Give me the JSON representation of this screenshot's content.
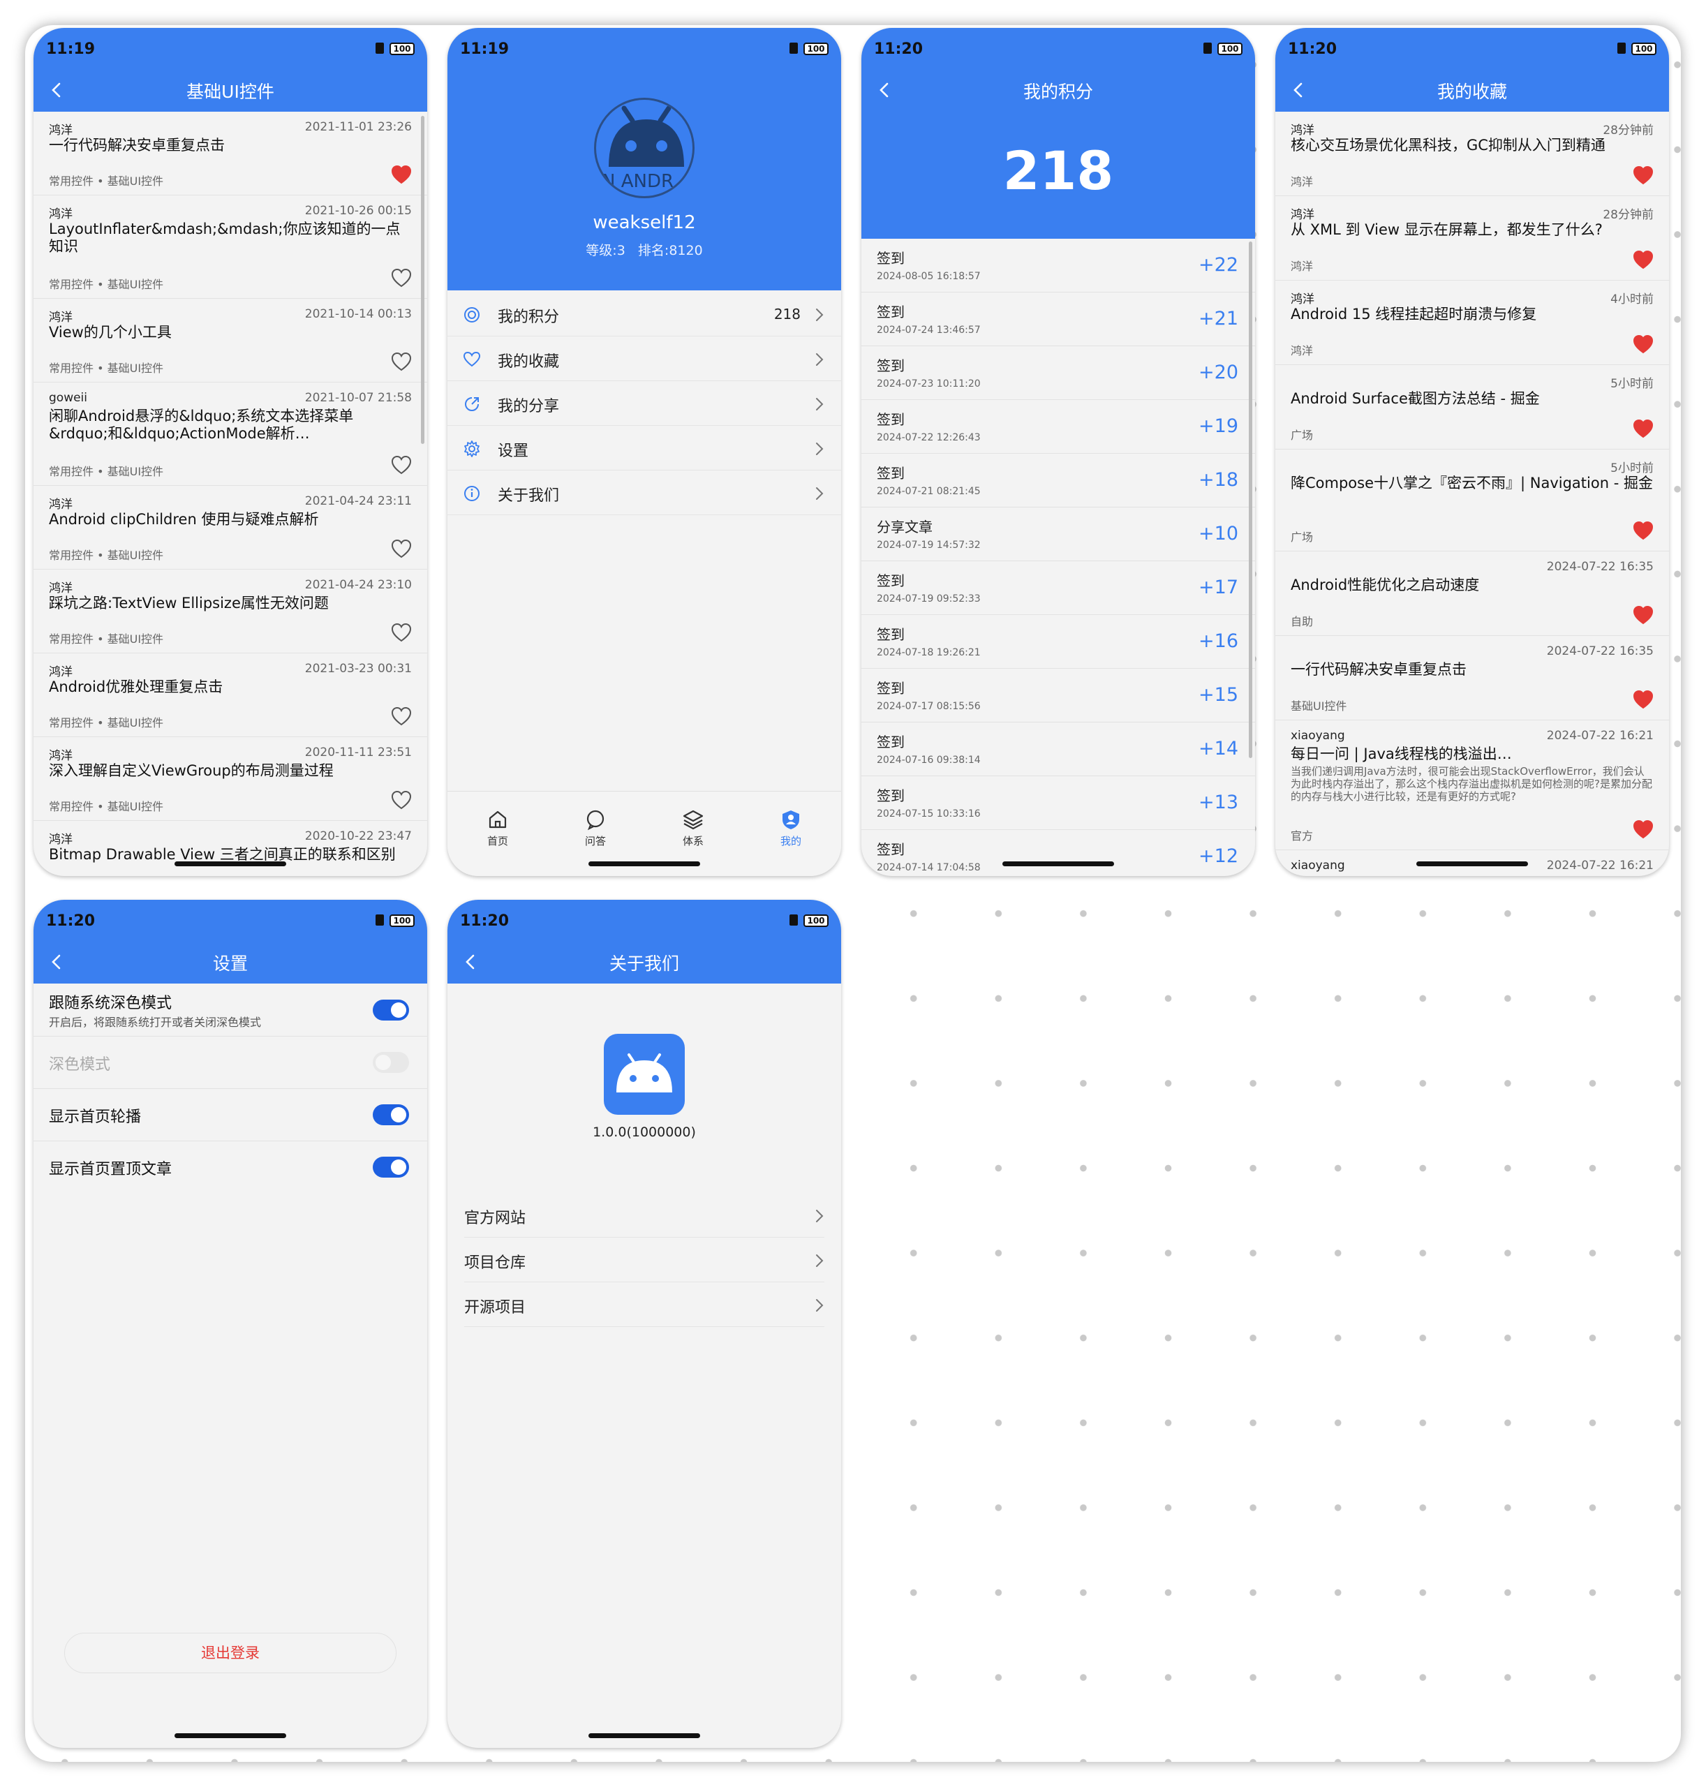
{
  "status": {
    "time_a": "11:19",
    "time_b": "11:20",
    "battery": "100"
  },
  "colors": {
    "primary": "#3a7ff0",
    "heart_active": "#e53935",
    "toggle_on": "#1d5fe0",
    "logout": "#e53935"
  },
  "screen1": {
    "title": "基础UI控件",
    "items": [
      {
        "author": "鸿洋",
        "date": "2021-11-01 23:26",
        "title": "一行代码解决安卓重复点击",
        "tags": "常用控件 • 基础UI控件",
        "liked": true
      },
      {
        "author": "鸿洋",
        "date": "2021-10-26 00:15",
        "title": "LayoutInflater&mdash;&mdash;你应该知道的一点知识",
        "tags": "常用控件 • 基础UI控件",
        "liked": false
      },
      {
        "author": "鸿洋",
        "date": "2021-10-14 00:13",
        "title": "View的几个小工具",
        "tags": "常用控件 • 基础UI控件",
        "liked": false
      },
      {
        "author": "goweii",
        "date": "2021-10-07 21:58",
        "title": "闲聊Android悬浮的&ldquo;系统文本选择菜单&rdquo;和&ldquo;ActionMode解析…",
        "tags": "常用控件 • 基础UI控件",
        "liked": false
      },
      {
        "author": "鸿洋",
        "date": "2021-04-24 23:11",
        "title": "Android clipChildren 使用与疑难点解析",
        "tags": "常用控件 • 基础UI控件",
        "liked": false
      },
      {
        "author": "鸿洋",
        "date": "2021-04-24 23:10",
        "title": "踩坑之路:TextView Ellipsize属性无效问题",
        "tags": "常用控件 • 基础UI控件",
        "liked": false
      },
      {
        "author": "鸿洋",
        "date": "2021-03-23 00:31",
        "title": "Android优雅处理重复点击",
        "tags": "常用控件 • 基础UI控件",
        "liked": false
      },
      {
        "author": "鸿洋",
        "date": "2020-11-11 23:51",
        "title": "深入理解自定义ViewGroup的布局测量过程",
        "tags": "常用控件 • 基础UI控件",
        "liked": false
      },
      {
        "author": "鸿洋",
        "date": "2020-10-22 23:47",
        "title": "Bitmap Drawable View 三者之间真正的联系和区别",
        "tags": "",
        "liked": false
      }
    ]
  },
  "screen2": {
    "username": "weakself12",
    "level": "等级:3",
    "rank": "排名:8120",
    "avatar_text": "N ANDR",
    "menu": [
      {
        "label": "我的积分",
        "value": "218",
        "icon": "points-icon"
      },
      {
        "label": "我的收藏",
        "value": "",
        "icon": "heart-outline-icon"
      },
      {
        "label": "我的分享",
        "value": "",
        "icon": "share-icon"
      },
      {
        "label": "设置",
        "value": "",
        "icon": "gear-icon"
      },
      {
        "label": "关于我们",
        "value": "",
        "icon": "info-icon"
      }
    ],
    "tabs": [
      {
        "label": "首页",
        "icon": "home-icon",
        "active": false
      },
      {
        "label": "问答",
        "icon": "chat-icon",
        "active": false
      },
      {
        "label": "体系",
        "icon": "layers-icon",
        "active": false
      },
      {
        "label": "我的",
        "icon": "user-shield-icon",
        "active": true
      }
    ]
  },
  "screen3": {
    "title": "我的积分",
    "total": "218",
    "records": [
      {
        "type": "签到",
        "date": "2024-08-05 16:18:57",
        "points": "+22"
      },
      {
        "type": "签到",
        "date": "2024-07-24 13:46:57",
        "points": "+21"
      },
      {
        "type": "签到",
        "date": "2024-07-23 10:11:20",
        "points": "+20"
      },
      {
        "type": "签到",
        "date": "2024-07-22 12:26:43",
        "points": "+19"
      },
      {
        "type": "签到",
        "date": "2024-07-21 08:21:45",
        "points": "+18"
      },
      {
        "type": "分享文章",
        "date": "2024-07-19 14:57:32",
        "points": "+10"
      },
      {
        "type": "签到",
        "date": "2024-07-19 09:52:33",
        "points": "+17"
      },
      {
        "type": "签到",
        "date": "2024-07-18 19:26:21",
        "points": "+16"
      },
      {
        "type": "签到",
        "date": "2024-07-17 08:15:56",
        "points": "+15"
      },
      {
        "type": "签到",
        "date": "2024-07-16 09:38:14",
        "points": "+14"
      },
      {
        "type": "签到",
        "date": "2024-07-15 10:33:16",
        "points": "+13"
      },
      {
        "type": "签到",
        "date": "2024-07-14 17:04:58",
        "points": "+12"
      }
    ]
  },
  "screen4": {
    "title": "我的收藏",
    "items": [
      {
        "author": "鸿洋",
        "date": "28分钟前",
        "title": "核心交互场景优化黑科技，GC抑制从入门到精通",
        "tag": "鸿洋",
        "desc": ""
      },
      {
        "author": "鸿洋",
        "date": "28分钟前",
        "title": "从 XML 到 View 显示在屏幕上，都发生了什么?",
        "tag": "鸿洋",
        "desc": ""
      },
      {
        "author": "鸿洋",
        "date": "4小时前",
        "title": "Android 15 线程挂起超时崩溃与修复",
        "tag": "鸿洋",
        "desc": ""
      },
      {
        "author": "",
        "date": "5小时前",
        "title": "Android Surface截图方法总结 - 掘金",
        "tag": "广场",
        "desc": ""
      },
      {
        "author": "",
        "date": "5小时前",
        "title": "降Compose十八掌之『密云不雨』| Navigation - 掘金",
        "tag": "广场",
        "desc": ""
      },
      {
        "author": "",
        "date": "2024-07-22 16:35",
        "title": "Android性能优化之启动速度",
        "tag": "自助",
        "desc": ""
      },
      {
        "author": "",
        "date": "2024-07-22 16:35",
        "title": "一行代码解决安卓重复点击",
        "tag": "基础UI控件",
        "desc": ""
      },
      {
        "author": "xiaoyang",
        "date": "2024-07-22 16:21",
        "title": "每日一问 | Java线程栈的栈溢出…",
        "tag": "官方",
        "desc": "当我们递归调用Java方法时，很可能会出现StackOverflowError，我们会认为此时栈内存溢出了，那么这个栈内存溢出虚拟机是如何检测的呢?是累加分配的内存与栈大小进行比较，还是有更好的方式呢?"
      },
      {
        "author": "xiaoyang",
        "date": "2024-07-22 16:21",
        "title": "",
        "tag": "",
        "desc": ""
      }
    ]
  },
  "screen5": {
    "title": "设置",
    "rows": [
      {
        "label": "跟随系统深色模式",
        "sub": "开启后，将跟随系统打开或者关闭深色模式",
        "on": true,
        "disabled": false
      },
      {
        "label": "深色模式",
        "sub": "",
        "on": false,
        "disabled": true
      },
      {
        "label": "显示首页轮播",
        "sub": "",
        "on": true,
        "disabled": false
      },
      {
        "label": "显示首页置顶文章",
        "sub": "",
        "on": true,
        "disabled": false
      }
    ],
    "logout": "退出登录"
  },
  "screen6": {
    "title": "关于我们",
    "version": "1.0.0(1000000)",
    "links": [
      "官方网站",
      "项目仓库",
      "开源项目"
    ]
  }
}
